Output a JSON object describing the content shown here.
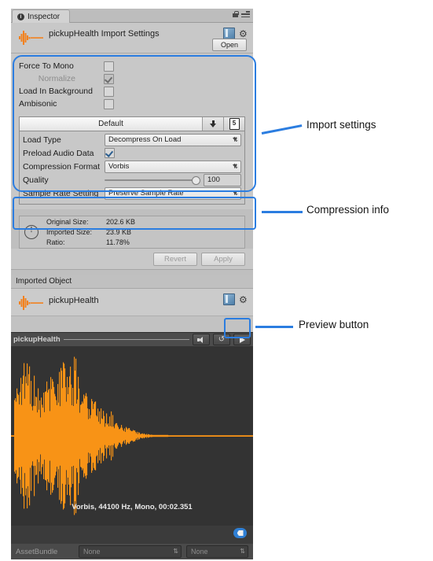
{
  "window": {
    "tab_label": "Inspector",
    "tab_icon": "info-circle-icon",
    "lock_icon": "lock-icon",
    "menu_icon": "hamburger-menu-icon"
  },
  "asset_header": {
    "icon": "audio-waveform-icon",
    "title": "pickupHealth Import Settings",
    "preset_icon": "preset-book-icon",
    "help_icon": "gear-icon",
    "open_button": "Open"
  },
  "import_settings": {
    "checkboxes": [
      {
        "label": "Force To Mono",
        "checked": false,
        "disabled": false
      },
      {
        "label": "Normalize",
        "checked": true,
        "disabled": true
      },
      {
        "label": "Load In Background",
        "checked": false,
        "disabled": false
      },
      {
        "label": "Ambisonic",
        "checked": false,
        "disabled": false
      }
    ],
    "platform_tab": "Default",
    "platform_icons": [
      "download-arrow-icon",
      "html5-platform-icon"
    ],
    "load_type": {
      "label": "Load Type",
      "value": "Decompress On Load"
    },
    "preload": {
      "label": "Preload Audio Data",
      "checked": true
    },
    "compression_format": {
      "label": "Compression Format",
      "value": "Vorbis"
    },
    "quality": {
      "label": "Quality",
      "value": "100",
      "percent": 100
    },
    "sample_rate": {
      "label": "Sample Rate Setting",
      "value": "Preserve Sample Rate"
    }
  },
  "compression_info": {
    "icon": "warning-info-icon",
    "rows": [
      {
        "key": "Original Size:",
        "value": "202.6 KB"
      },
      {
        "key": "Imported Size:",
        "value": "23.9 KB"
      },
      {
        "key": "Ratio:",
        "value": "11.78%"
      }
    ]
  },
  "apply_bar": {
    "revert": "Revert",
    "apply": "Apply"
  },
  "imported_object": {
    "section_title": "Imported Object",
    "icon": "audio-waveform-icon",
    "name": "pickupHealth",
    "preset_icon": "preset-book-icon",
    "help_icon": "gear-icon"
  },
  "preview": {
    "name": "pickupHealth",
    "volume_icon": "speaker-icon",
    "loop_icon": "loop-icon",
    "play_icon": "play-icon",
    "waveform_info": "Vorbis, 44100 Hz, Mono, 00:02.351",
    "waveform_color": "#F89316",
    "background_color": "#333333"
  },
  "asset_bundle": {
    "tag_icon": "tag-badge-icon",
    "label": "AssetBundle",
    "bundle_value": "None",
    "variant_value": "None"
  },
  "annotations": [
    {
      "text": "Import settings"
    },
    {
      "text": "Compression info"
    },
    {
      "text": "Preview button"
    }
  ],
  "accent_color": "#2B7DE0"
}
